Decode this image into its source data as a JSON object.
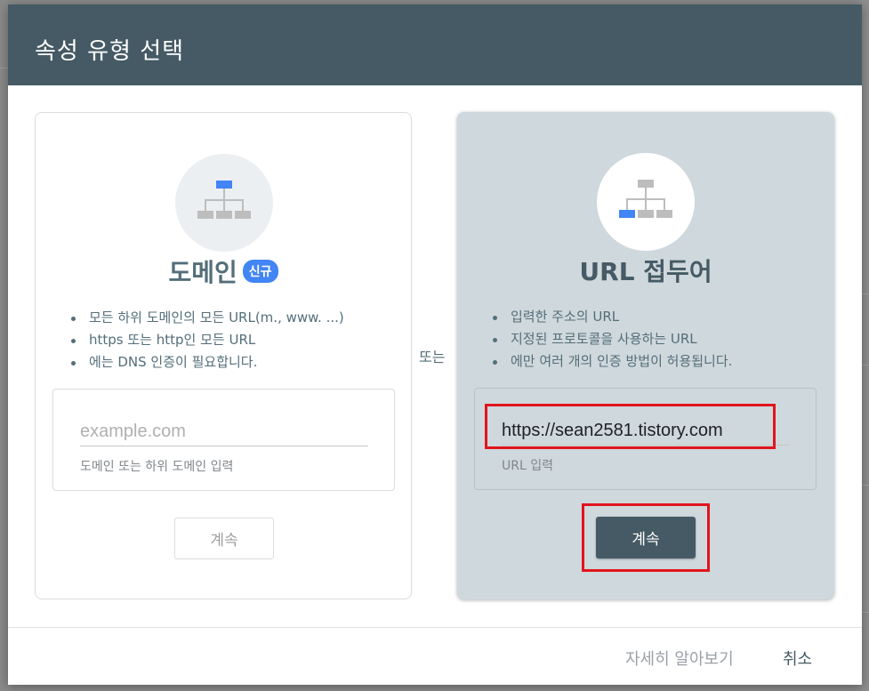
{
  "dialog": {
    "title": "속성 유형 선택",
    "or_label": "또는"
  },
  "domain_card": {
    "heading": "도메인",
    "badge": "신규",
    "features": [
      "모든 하위 도메인의 모든 URL(m., www. ...)",
      "https 또는 http인 모든 URL",
      "에는 DNS 인증이 필요합니다."
    ],
    "input_value": "",
    "input_placeholder": "example.com",
    "input_help": "도메인 또는 하위 도메인 입력",
    "continue_label": "계속"
  },
  "url_card": {
    "heading": "URL 접두어",
    "features": [
      "입력한 주소의 URL",
      "지정된 프로토콜을 사용하는 URL",
      "에만 여러 개의 인증 방법이 허용됩니다."
    ],
    "input_value": "https://sean2581.tistory.com",
    "input_placeholder": "",
    "input_help": "URL 입력",
    "continue_label": "계속"
  },
  "footer": {
    "learn_more": "자세히 알아보기",
    "cancel": "취소"
  },
  "colors": {
    "header": "#455a64",
    "accent_blue": "#4285f4",
    "highlight_red": "#e0151d",
    "url_card_bg": "#cfd8dc"
  },
  "icons": {
    "domain_card": "sitemap-icon-top-highlighted",
    "url_card": "sitemap-icon-leaf-highlighted"
  }
}
